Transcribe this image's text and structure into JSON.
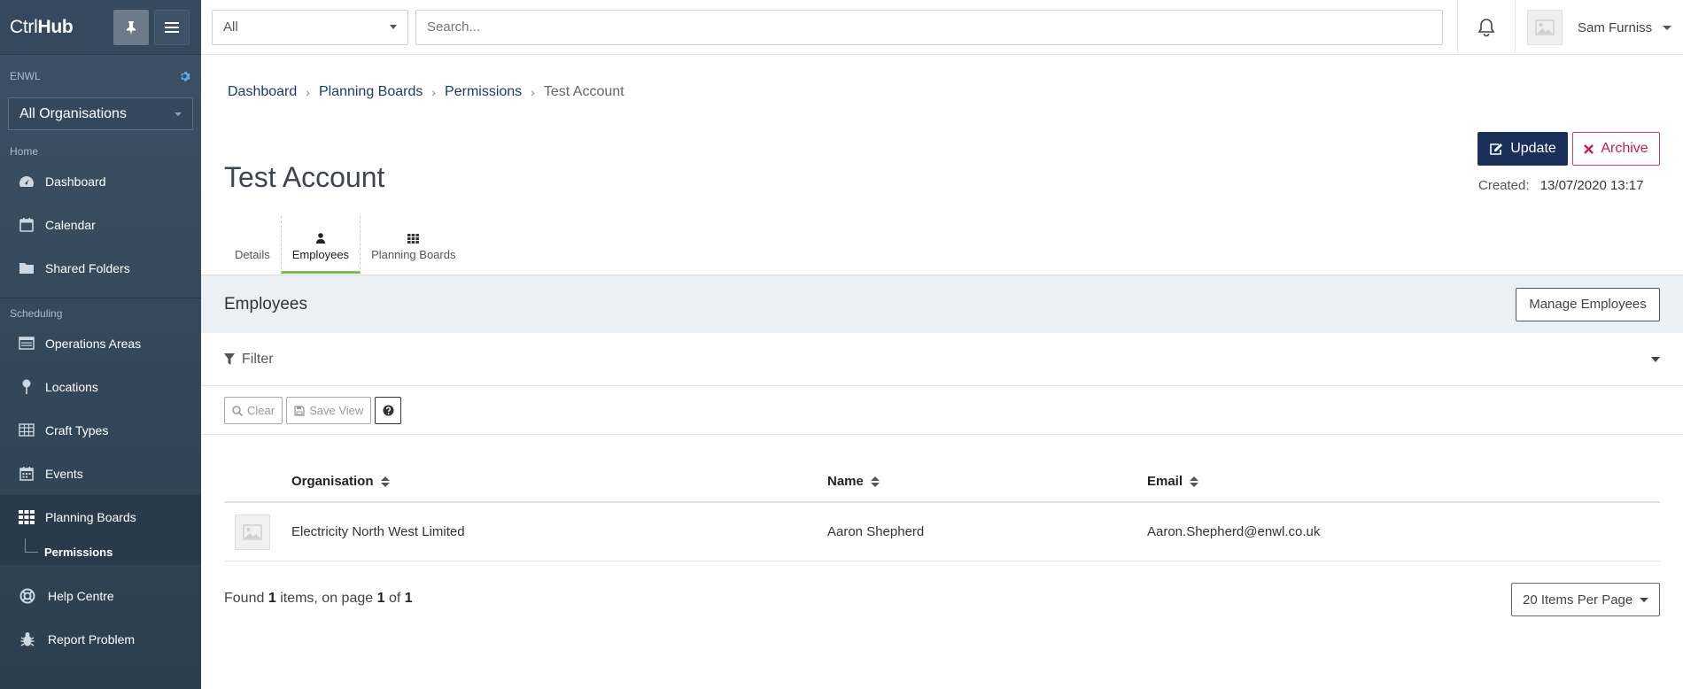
{
  "app": {
    "logo_light": "Ctrl",
    "logo_bold": "Hub"
  },
  "sidebar": {
    "tenant": "ENWL",
    "org_select": "All Organisations",
    "sections": {
      "home": "Home",
      "scheduling": "Scheduling"
    },
    "items": {
      "dashboard": "Dashboard",
      "calendar": "Calendar",
      "shared_folders": "Shared Folders",
      "operations_areas": "Operations Areas",
      "locations": "Locations",
      "craft_types": "Craft Types",
      "events": "Events",
      "planning_boards": "Planning Boards",
      "permissions": "Permissions",
      "help_centre": "Help Centre",
      "report_problem": "Report Problem"
    }
  },
  "topbar": {
    "scope": "All",
    "search_placeholder": "Search...",
    "user_name": "Sam Furniss"
  },
  "breadcrumb": [
    "Dashboard",
    "Planning Boards",
    "Permissions",
    "Test Account"
  ],
  "page": {
    "title": "Test Account",
    "update_label": "Update",
    "archive_label": "Archive",
    "created_label": "Created:",
    "created_value": "13/07/2020 13:17"
  },
  "tabs": [
    "Details",
    "Employees",
    "Planning Boards"
  ],
  "employees": {
    "heading": "Employees",
    "manage_label": "Manage Employees",
    "filter_label": "Filter",
    "clear_label": "Clear",
    "save_view_label": "Save View",
    "columns": [
      "Organisation",
      "Name",
      "Email"
    ],
    "rows": [
      {
        "organisation": "Electricity North West Limited",
        "name": "Aaron Shepherd",
        "email": "Aaron.Shepherd@enwl.co.uk"
      }
    ],
    "found_prefix": "Found",
    "found_count": "1",
    "found_mid": "items, on page",
    "page_current": "1",
    "of_label": "of",
    "page_total": "1",
    "per_page": "20 Items Per Page"
  },
  "colors": {
    "sidebar_bg": "#34495e",
    "primary": "#1a2f5a",
    "danger": "#c81d55",
    "tab_active": "#7bbb5a"
  }
}
